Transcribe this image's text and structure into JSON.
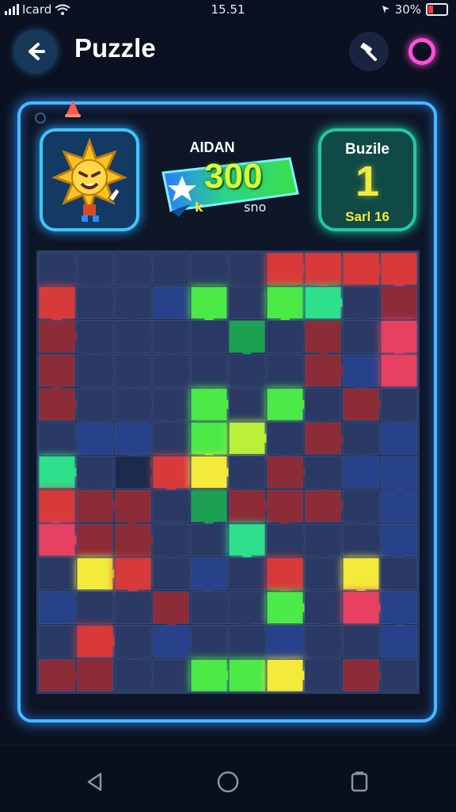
{
  "status": {
    "carrier": "Icard",
    "time": "15.51",
    "battery": "30%",
    "battery_level": 0.3
  },
  "header": {
    "title": "Puzzle",
    "icons": [
      "back-arrow-icon",
      "hammer-icon",
      "ring-icon"
    ]
  },
  "player": {
    "name": "AIDAN",
    "score": "300",
    "score_sub_left": "k",
    "score_sub_right": "sno"
  },
  "level": {
    "title": "Buzile",
    "number": "1",
    "sub": "Sarl 16"
  },
  "board": {
    "cols": 10,
    "rows": 12,
    "colors": {
      "N": "#2a3a64",
      "B": "#27428a",
      "D": "#1c2a4e",
      "R": "#d83a3a",
      "r": "#8c2c38",
      "G": "#4cea46",
      "g": "#1ea052",
      "T": "#2ee08a",
      "Y": "#f4ea3a",
      "P": "#e84060",
      "L": "#b8f03a"
    },
    "grid": [
      "NNNNNNRRRR",
      "RNNBGNGTNr",
      "rNNNNgNrNP",
      "rNNNNNNrBP",
      "rNNNGNGNrN",
      "NBBNGLNrNB",
      "TNDRYNrNBB",
      "RrrNgrrrNB",
      "PrrNNTNNNB",
      "NYRNBNRNYN",
      "BNNrNNGNPB",
      "NRNBNNBNNB",
      "rrNNGGYNrN"
    ]
  },
  "navbar": {
    "icons": [
      "back-triangle-icon",
      "home-circle-icon",
      "recents-square-icon"
    ]
  }
}
